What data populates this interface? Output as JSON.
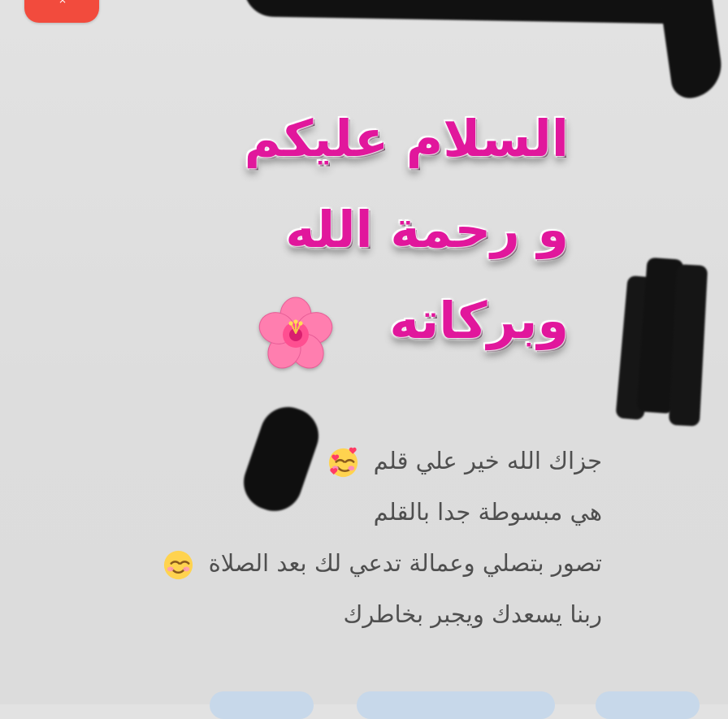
{
  "window": {
    "close_label": "×"
  },
  "message": {
    "greeting_lines": [
      "السلام عليكم",
      "و رحمة الله",
      "وبركاته"
    ],
    "greeting_emoji_icon": "hibiscus-icon",
    "body_lines": [
      {
        "text": "جزاك الله خير علي قلم",
        "emoji_icon": "smiling-face-with-hearts-icon"
      },
      {
        "text": "هي مبسوطة جدا بالقلم",
        "emoji_icon": ""
      },
      {
        "text": "تصور بتصلي وعمالة تدعي لك بعد الصلاة",
        "emoji_icon": "smiling-face-icon"
      },
      {
        "text": "ربنا يسعدك ويجبر بخاطرك",
        "emoji_icon": ""
      }
    ]
  },
  "colors": {
    "background": "#e0e0e0",
    "greeting_text": "#e1179c",
    "greeting_outline": "#ffffff",
    "body_text": "#4f4f4f",
    "close_badge": "#f24b3d",
    "chip": "#c7d8ea"
  }
}
